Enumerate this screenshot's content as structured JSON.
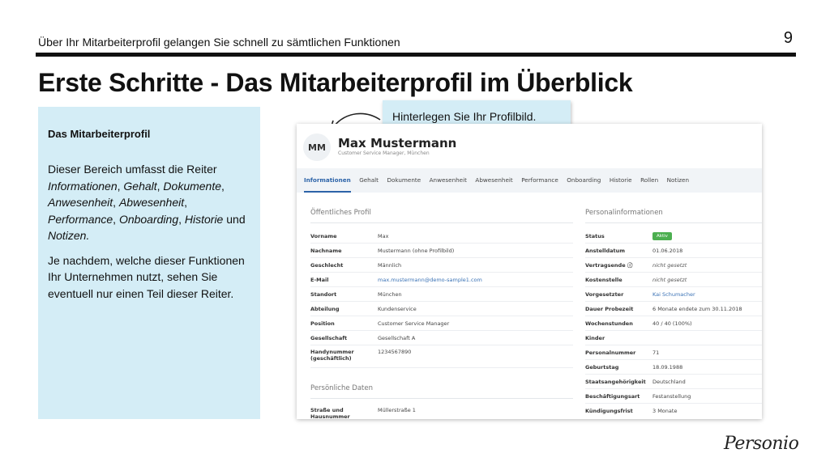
{
  "slide": {
    "subtitle": "Über Ihr Mitarbeiterprofil gelangen Sie schnell zu sämtlichen Funktionen",
    "page_number": "9",
    "title": "Erste Schritte - Das Mitarbeiterprofil im Überblick"
  },
  "panel": {
    "heading": "Das Mitarbeiterprofil",
    "p1_text": "Dieser Bereich umfasst die Reiter ",
    "p1_tabs": [
      "Informationen",
      "Gehalt",
      "Dokumente",
      "Anwesenheit",
      "Abwesenheit",
      "Performance",
      "Onboarding",
      "Historie"
    ],
    "p1_and": "und",
    "p1_last": "Notizen.",
    "p2": "Je nachdem, welche dieser Funktionen Ihr Unternehmen nutzt, sehen Sie eventuell nur einen Teil dieser Reiter."
  },
  "callout": {
    "text": "Hinterlegen Sie Ihr Profilbild."
  },
  "profile": {
    "initials": "MM",
    "name": "Max Mustermann",
    "role": "Customer Service Manager, München",
    "tabs": [
      "Informationen",
      "Gehalt",
      "Dokumente",
      "Anwesenheit",
      "Abwesenheit",
      "Performance",
      "Onboarding",
      "Historie",
      "Rollen",
      "Notizen"
    ],
    "active_tab_index": 0
  },
  "public_profile": {
    "title": "Öffentliches Profil",
    "rows": [
      {
        "label": "Vorname",
        "value": "Max"
      },
      {
        "label": "Nachname",
        "value": "Mustermann (ohne Profilbild)"
      },
      {
        "label": "Geschlecht",
        "value": "Männlich"
      },
      {
        "label": "E-Mail",
        "value": "max.mustermann@demo-sample1.com"
      },
      {
        "label": "Standort",
        "value": "München"
      },
      {
        "label": "Abteilung",
        "value": "Kundenservice"
      },
      {
        "label": "Position",
        "value": "Customer Service Manager"
      },
      {
        "label": "Gesellschaft",
        "value": "Gesellschaft A"
      },
      {
        "label": "Handynummer (geschäftlich)",
        "value": "1234567890"
      }
    ]
  },
  "personal_data": {
    "title": "Persönliche Daten",
    "rows": [
      {
        "label": "Straße und Hausnummer",
        "value": "Müllerstraße 1"
      }
    ]
  },
  "hr_info": {
    "title": "Personalinformationen",
    "rows": [
      {
        "label": "Status",
        "value": "Aktiv"
      },
      {
        "label": "Anstelldatum",
        "value": "01.06.2018"
      },
      {
        "label": "Vertragsende ⓘ",
        "value": "nicht gesetzt"
      },
      {
        "label": "Kostenstelle",
        "value": "nicht gesetzt"
      },
      {
        "label": "Vorgesetzter",
        "value": "Kai Schumacher"
      },
      {
        "label": "Dauer Probezeit",
        "value": "6 Monate endete zum 30.11.2018"
      },
      {
        "label": "Wochenstunden",
        "value": "40 / 40 (100%)"
      },
      {
        "label": "Kinder",
        "value": ""
      },
      {
        "label": "Personalnummer",
        "value": "71"
      },
      {
        "label": "Geburtstag",
        "value": "18.09.1988"
      },
      {
        "label": "Staatsangehörigkeit",
        "value": "Deutschland"
      },
      {
        "label": "Beschäftigungsart",
        "value": "Festanstellung"
      },
      {
        "label": "Kündigungsfrist",
        "value": "3 Monate"
      }
    ]
  },
  "logo": {
    "text": "Personio"
  },
  "colors": {
    "accent": "#2c63a8",
    "panel": "#d4edf6",
    "status": "#4caf50",
    "link": "#3a72b5"
  }
}
